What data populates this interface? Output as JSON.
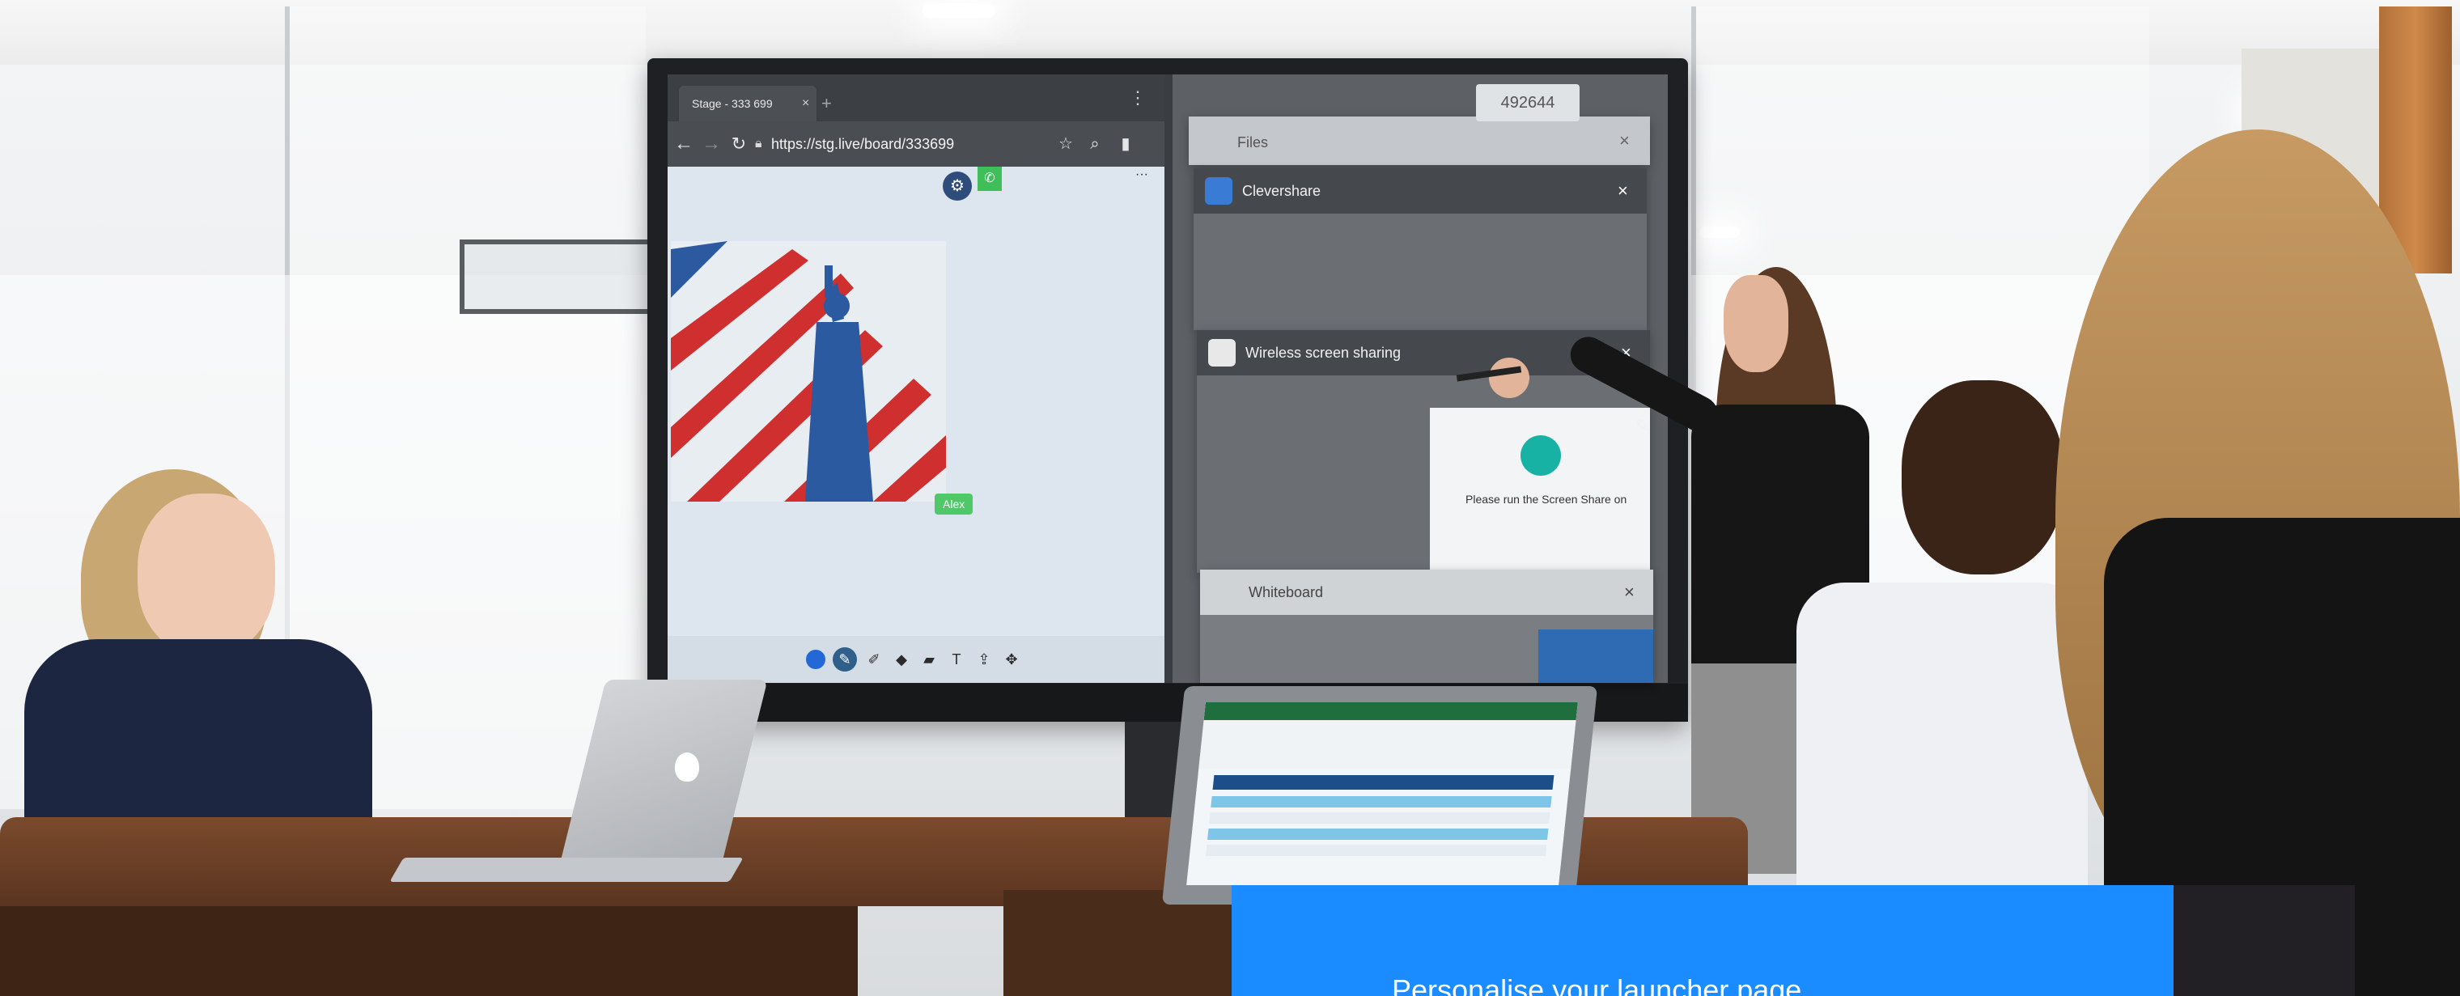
{
  "browser": {
    "tab_title": "Stage - 333 699",
    "tab_close": "×",
    "tab_new": "+",
    "menu": "⋮",
    "url": "https://stg.live/board/333699"
  },
  "board": {
    "user_label": "Alex",
    "more": "···"
  },
  "cards": {
    "session_code": "492644",
    "files": {
      "title": "Files",
      "close": "×"
    },
    "clevershare": {
      "title": "Clevershare",
      "close": "×"
    },
    "wireless": {
      "title": "Wireless screen sharing",
      "close": "×",
      "dialog_text": "Please run the Screen Share on"
    },
    "whiteboard": {
      "title": "Whiteboard",
      "close": "×"
    }
  },
  "promo": {
    "text": "Personalise your launcher page"
  },
  "colors": {
    "promo_blue": "#1a8cff",
    "bezel": "#1f2023",
    "alex_green": "#4fc968",
    "flag_red": "#cf2f2f",
    "statue_blue": "#2c5aa0"
  }
}
